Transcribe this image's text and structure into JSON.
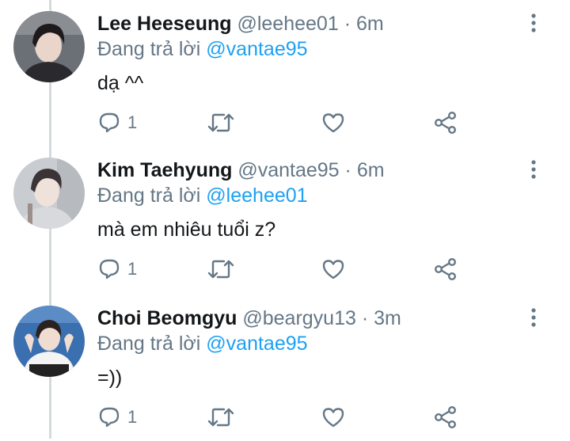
{
  "tweets": [
    {
      "display_name": "Lee Heeseung",
      "handle": "@leehee01",
      "separator": "·",
      "time": "6m",
      "reply_prefix": "Đang trả lời",
      "reply_to": "@vantae95",
      "text": "dạ ^^",
      "reply_count": "1",
      "avatar": {
        "bg": "#6b6f76",
        "hair": "#1e1a1c",
        "skin": "#e9d5c9",
        "cloth": "#2a2a2e"
      }
    },
    {
      "display_name": "Kim Taehyung",
      "handle": "@vantae95",
      "separator": "·",
      "time": "6m",
      "reply_prefix": "Đang trả lời",
      "reply_to": "@leehee01",
      "text": "mà em nhiêu tuổi z?",
      "reply_count": "1",
      "avatar": {
        "bg": "#c9ccd1",
        "hair": "#3b3436",
        "skin": "#efe2da",
        "cloth": "#d8d9dc"
      }
    },
    {
      "display_name": "Choi Beomgyu",
      "handle": "@beargyu13",
      "separator": "·",
      "time": "3m",
      "reply_prefix": "Đang trả lời",
      "reply_to": "@vantae95",
      "text": "=))",
      "reply_count": "1",
      "avatar": {
        "bg": "#3a6fb0",
        "hair": "#2b2220",
        "skin": "#f0dcd0",
        "cloth": "#f4f4f4"
      }
    }
  ],
  "colors": {
    "primary_text": "#14171a",
    "secondary_text": "#657786",
    "link": "#1da1f2",
    "icon": "#657786",
    "thread_line": "#d5dadd"
  },
  "icons": [
    "reply-icon",
    "retweet-icon",
    "like-icon",
    "share-icon",
    "more-vertical-icon"
  ]
}
